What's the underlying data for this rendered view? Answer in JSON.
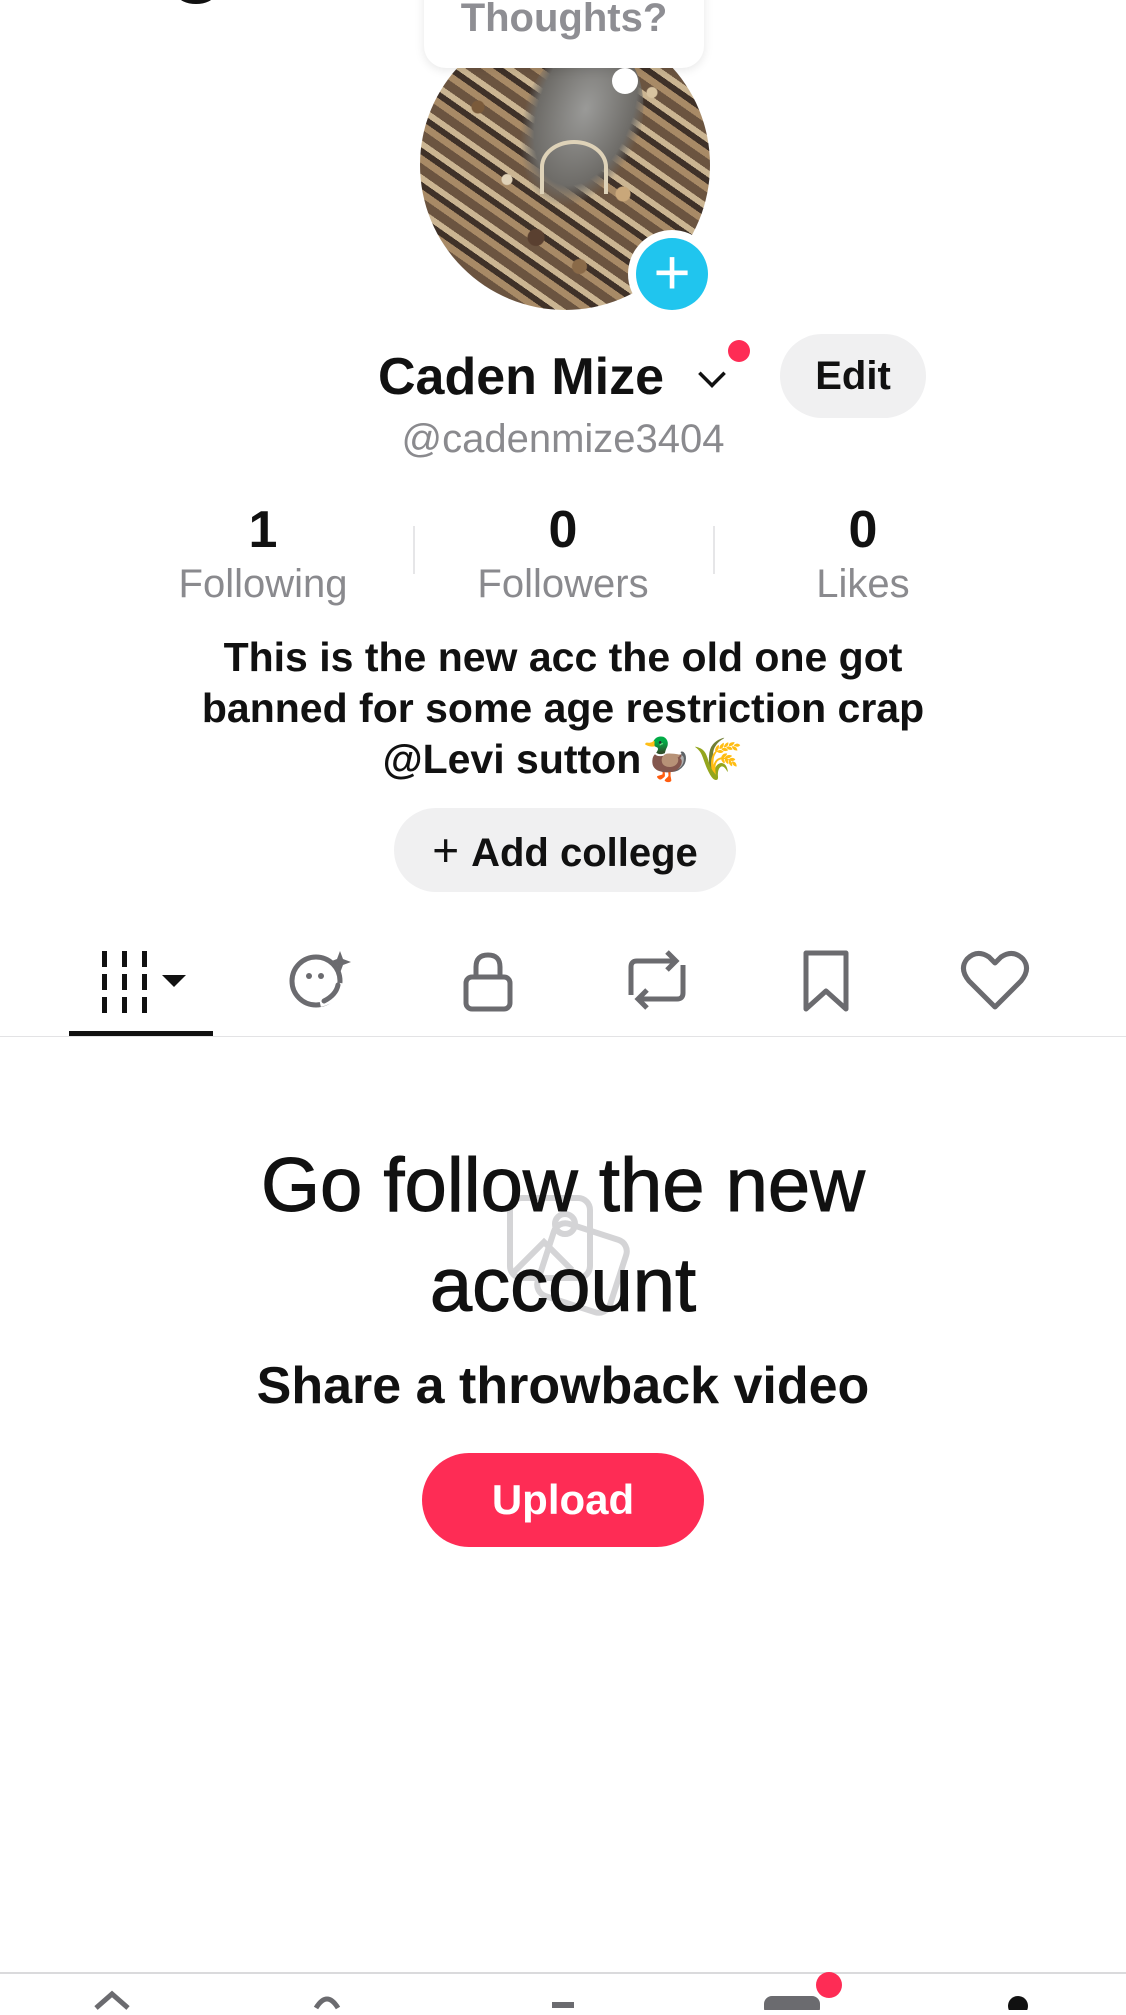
{
  "thought_bubble": {
    "text": "Thoughts?"
  },
  "profile": {
    "name": "Caden Mize",
    "username": "@cadenmize3404",
    "edit_label": "Edit"
  },
  "stats": [
    {
      "value": "1",
      "label": "Following"
    },
    {
      "value": "0",
      "label": "Followers"
    },
    {
      "value": "0",
      "label": "Likes"
    }
  ],
  "bio": {
    "line1": "This is the new acc the old one got",
    "line2": "banned for some age restriction crap",
    "line3": "@Levi sutton🦆🌾"
  },
  "college_button": {
    "plus": "+",
    "label": "Add college"
  },
  "tabs": [
    {
      "icon": "grid-icon",
      "selected": true
    },
    {
      "icon": "repost-face-icon"
    },
    {
      "icon": "lock-icon"
    },
    {
      "icon": "repost-icon"
    },
    {
      "icon": "bookmark-icon"
    },
    {
      "icon": "heart-icon"
    }
  ],
  "empty_state": {
    "title_line1": "Go follow the new",
    "title_line2": "account",
    "subtitle": "Share a throwback video",
    "upload_label": "Upload"
  },
  "colors": {
    "accent_red": "#fe2c55",
    "avatar_add_blue": "#20c5ee",
    "muted_text": "#8a8a8e"
  }
}
